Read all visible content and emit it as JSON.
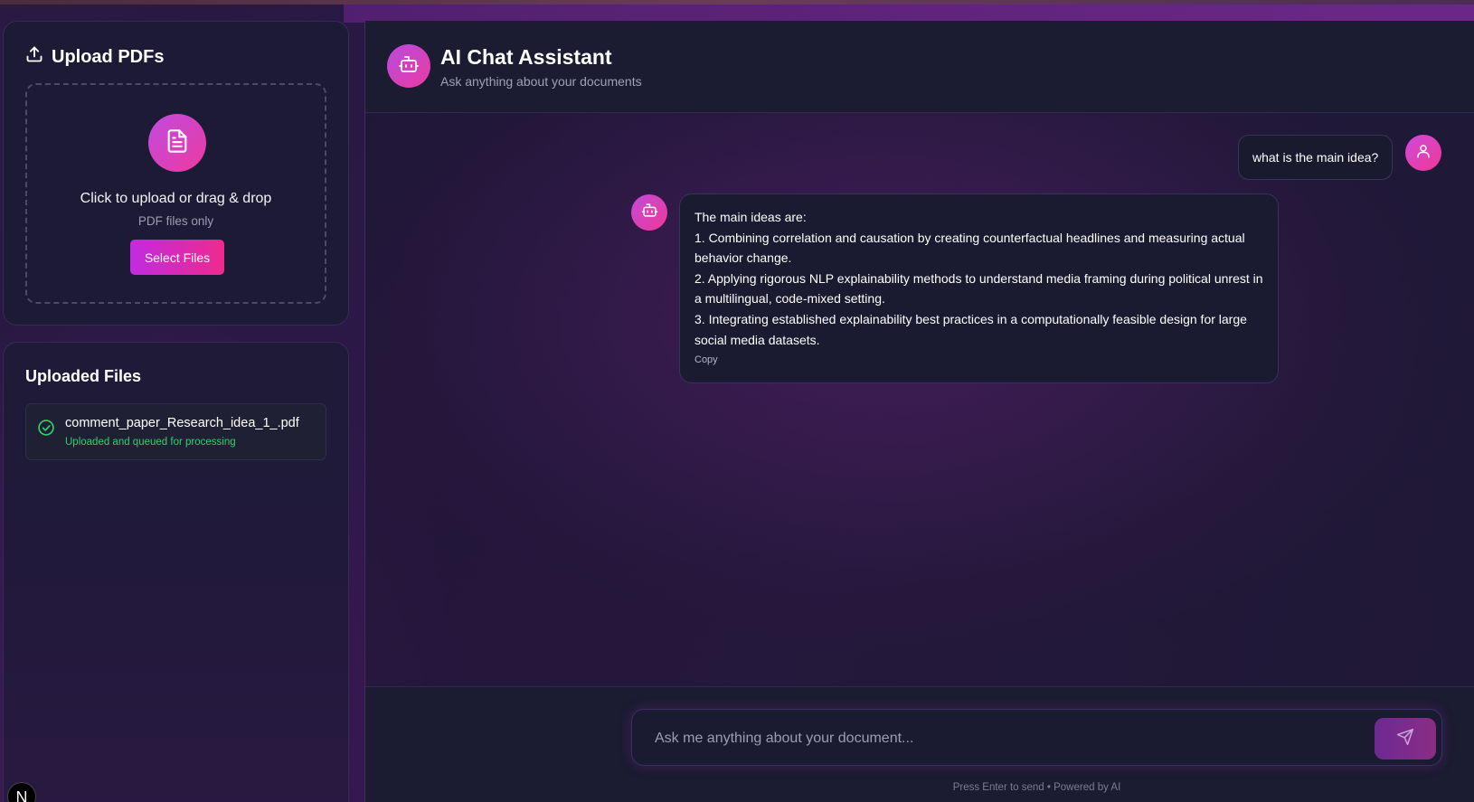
{
  "sidebar": {
    "upload": {
      "title": "Upload PDFs",
      "icon": "upload-icon",
      "dropzone_icon": "file-text-icon",
      "dropzone_title": "Click to upload or drag & drop",
      "dropzone_sub": "PDF files only",
      "select_button": "Select Files"
    },
    "files": {
      "title": "Uploaded Files",
      "items": [
        {
          "name": "comment_paper_Research_idea_1_.pdf",
          "status": "Uploaded and queued for processing",
          "icon": "check-circle-icon"
        }
      ]
    },
    "badge": "N"
  },
  "chat": {
    "header": {
      "title": "AI Chat Assistant",
      "subtitle": "Ask anything about your documents",
      "icon": "bot-icon"
    },
    "messages": [
      {
        "role": "user",
        "text": "what is the main idea?",
        "avatar_icon": "user-icon"
      },
      {
        "role": "assistant",
        "avatar_icon": "bot-icon",
        "lines": [
          "The main ideas are:",
          "1. Combining correlation and causation by creating counterfactual headlines and measuring actual",
          "behavior change.",
          "2. Applying rigorous NLP explainability methods to understand media framing during political unrest in",
          "a multilingual, code-mixed setting.",
          "3. Integrating established explainability best practices in a computationally feasible design for large",
          "social media datasets."
        ],
        "copy_label": "Copy"
      }
    ],
    "input": {
      "placeholder": "Ask me anything about your document...",
      "value": "",
      "send_icon": "send-icon"
    },
    "hint": "Press Enter to send • Powered by AI"
  },
  "colors": {
    "accent_start": "#c12be0",
    "accent_end": "#ef2a8e",
    "success": "#2ed36a",
    "panel_bg": "#1d1a35"
  }
}
